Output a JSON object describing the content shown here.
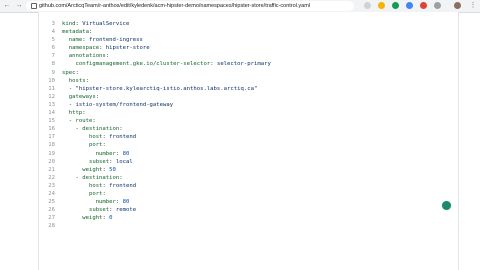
{
  "browser": {
    "url": "github.com/ArcticqTeam/r-anthos/edit/kyledenk/acm-hipster-demo/namespaces/hipster-store/traffic-control.yaml"
  },
  "colors": {
    "ext_yellow": "#f4b400",
    "ext_green": "#0f9d58",
    "ext_blue": "#4285f4",
    "ext_red": "#db4437",
    "fab": "#1b8a6b"
  },
  "editor": {
    "lines": [
      {
        "num": "3",
        "text": "kind: VirtualService"
      },
      {
        "num": "4",
        "text": "metadata:"
      },
      {
        "num": "5",
        "text": "  name: frontend-ingress"
      },
      {
        "num": "6",
        "text": "  namespace: hipster-store"
      },
      {
        "num": "7",
        "text": "  annotations:"
      },
      {
        "num": "8",
        "text": "    configmanagement.gke.io/cluster-selector: selector-primary"
      },
      {
        "num": "9",
        "text": "spec:"
      },
      {
        "num": "10",
        "text": "  hosts:"
      },
      {
        "num": "11",
        "text": "  - \"hipster-store.kylearctiq-istio.anthos.labs.arctiq.ca\""
      },
      {
        "num": "12",
        "text": "  gateways:"
      },
      {
        "num": "13",
        "text": "  - istio-system/frontend-gateway"
      },
      {
        "num": "14",
        "text": "  http:"
      },
      {
        "num": "15",
        "text": "  - route:"
      },
      {
        "num": "16",
        "text": "    - destination:"
      },
      {
        "num": "17",
        "text": "        host: frontend"
      },
      {
        "num": "18",
        "text": "        port:"
      },
      {
        "num": "19",
        "text": "          number: 80"
      },
      {
        "num": "20",
        "text": "        subset: local"
      },
      {
        "num": "21",
        "text": "      weight: 50"
      },
      {
        "num": "22",
        "text": "    - destination:"
      },
      {
        "num": "23",
        "text": "        host: frontend"
      },
      {
        "num": "24",
        "text": "        port:"
      },
      {
        "num": "25",
        "text": "          number: 80"
      },
      {
        "num": "26",
        "text": "        subset: remote"
      },
      {
        "num": "27",
        "text": "      weight: 0"
      },
      {
        "num": "28",
        "text": ""
      }
    ]
  }
}
